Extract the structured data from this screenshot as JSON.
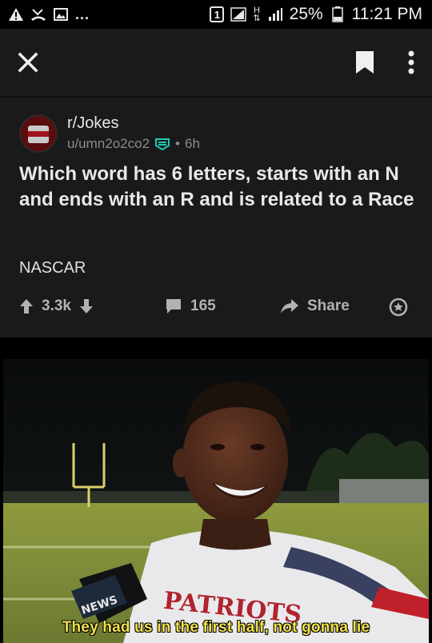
{
  "status_bar": {
    "battery": "25%",
    "time": "11:21 PM",
    "dots": "...",
    "sim_slot": "1",
    "network_h": "H"
  },
  "post": {
    "subreddit": "r/Jokes",
    "username": "u/umn2o2co2",
    "age": "6h",
    "separator": "•",
    "title": "Which word has 6 letters, starts with an N and ends with an R and is related to a Race",
    "body": "NASCAR",
    "votes": "3.3k",
    "comments": "165",
    "share_label": "Share"
  },
  "meme": {
    "caption": "They had us in the first half, not gonna lie",
    "mic_brand": "NEWS",
    "jersey_text": "PATRIOTS"
  },
  "colors": {
    "background": "#000000",
    "card": "#1a1a1b",
    "mod_badge": "#24c7b4",
    "caption": "#f1e34a"
  },
  "icons": [
    "warning-icon",
    "missed-call-icon",
    "image-icon",
    "sim-icon",
    "signal-icon",
    "battery-icon",
    "close-icon",
    "bookmark-icon",
    "more-icon",
    "upvote-icon",
    "downvote-icon",
    "comment-icon",
    "share-icon",
    "award-icon"
  ]
}
